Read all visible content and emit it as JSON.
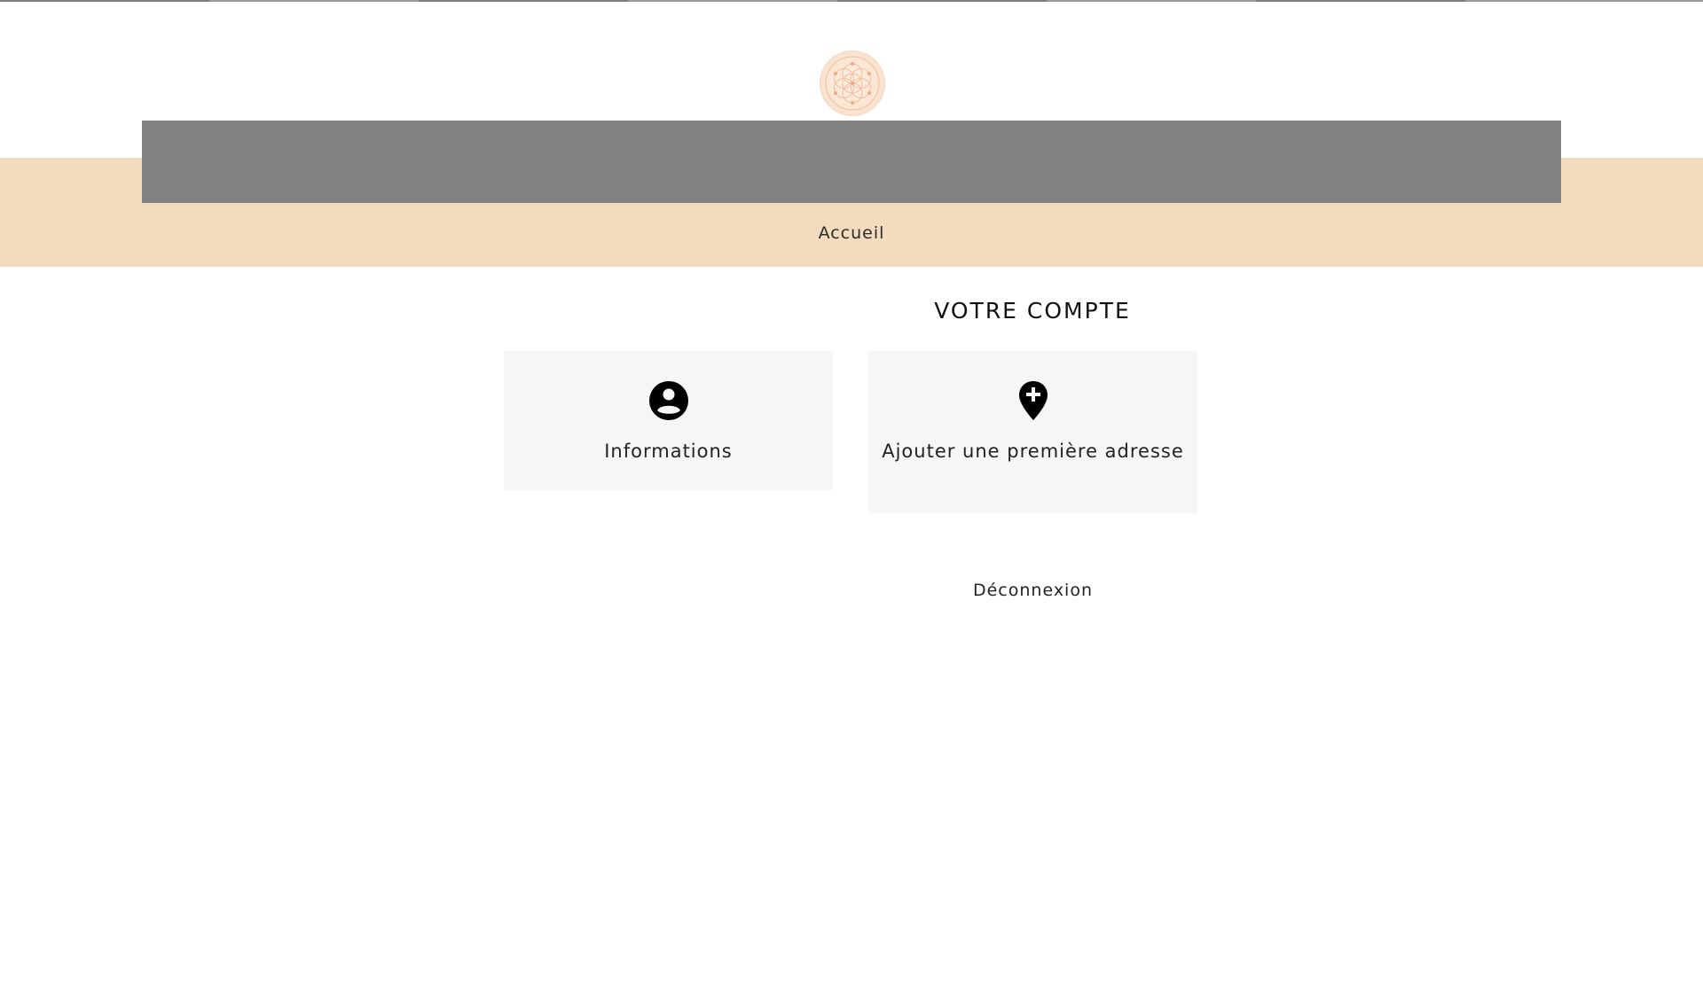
{
  "breadcrumb": {
    "home_label": "Accueil"
  },
  "main": {
    "title": "VOTRE COMPTE",
    "cards": [
      {
        "label": "Informations",
        "icon": "account-circle-icon"
      },
      {
        "label": "Ajouter une première adresse",
        "icon": "add-location-pin-icon"
      }
    ],
    "logout_label": "Déconnexion"
  },
  "colors": {
    "peach_band": "#f2dcbd",
    "banner_gray": "#828282",
    "card_bg": "#f7f6f7",
    "logo_accent": "#f2a97a"
  }
}
